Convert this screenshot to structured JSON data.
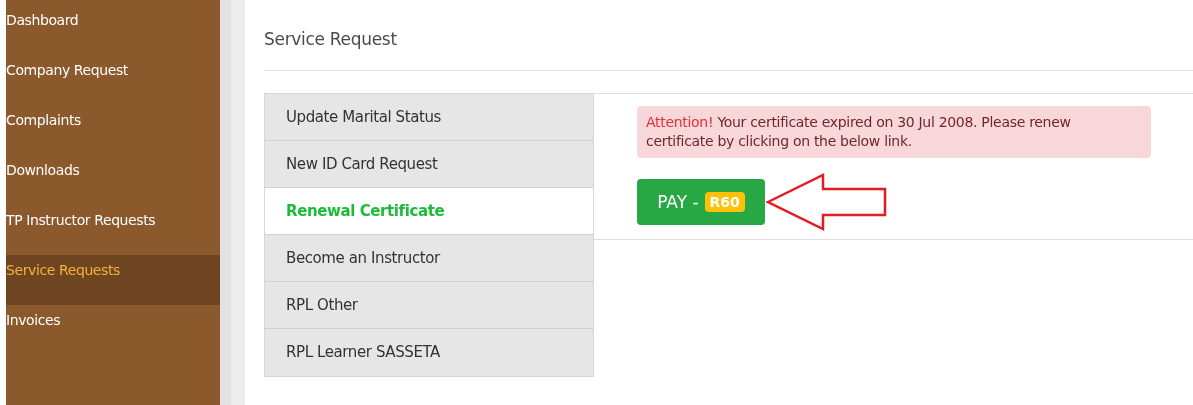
{
  "sidebar": {
    "items": [
      {
        "label": "Dashboard",
        "selected": false
      },
      {
        "label": "Company Request",
        "selected": false
      },
      {
        "label": "Complaints",
        "selected": false
      },
      {
        "label": "Downloads",
        "selected": false
      },
      {
        "label": "TP Instructor Requests",
        "selected": false
      },
      {
        "label": "Service Requests",
        "selected": true
      },
      {
        "label": "Invoices",
        "selected": false
      }
    ]
  },
  "card": {
    "title": "Service Request",
    "tabs": [
      {
        "label": "Update Marital Status",
        "selected": false
      },
      {
        "label": "New ID Card Request",
        "selected": false
      },
      {
        "label": "Renewal Certificate",
        "selected": true
      },
      {
        "label": "Become an Instructor",
        "selected": false
      },
      {
        "label": "RPL Other",
        "selected": false
      },
      {
        "label": "RPL Learner SASSETA",
        "selected": false
      }
    ],
    "alert": {
      "heading": "Attention!",
      "message": "Your certificate expired on 30 Jul 2008. Please renew certificate by clicking on the below link."
    },
    "pay_button": {
      "label": "PAY -",
      "amount": "R60"
    }
  }
}
